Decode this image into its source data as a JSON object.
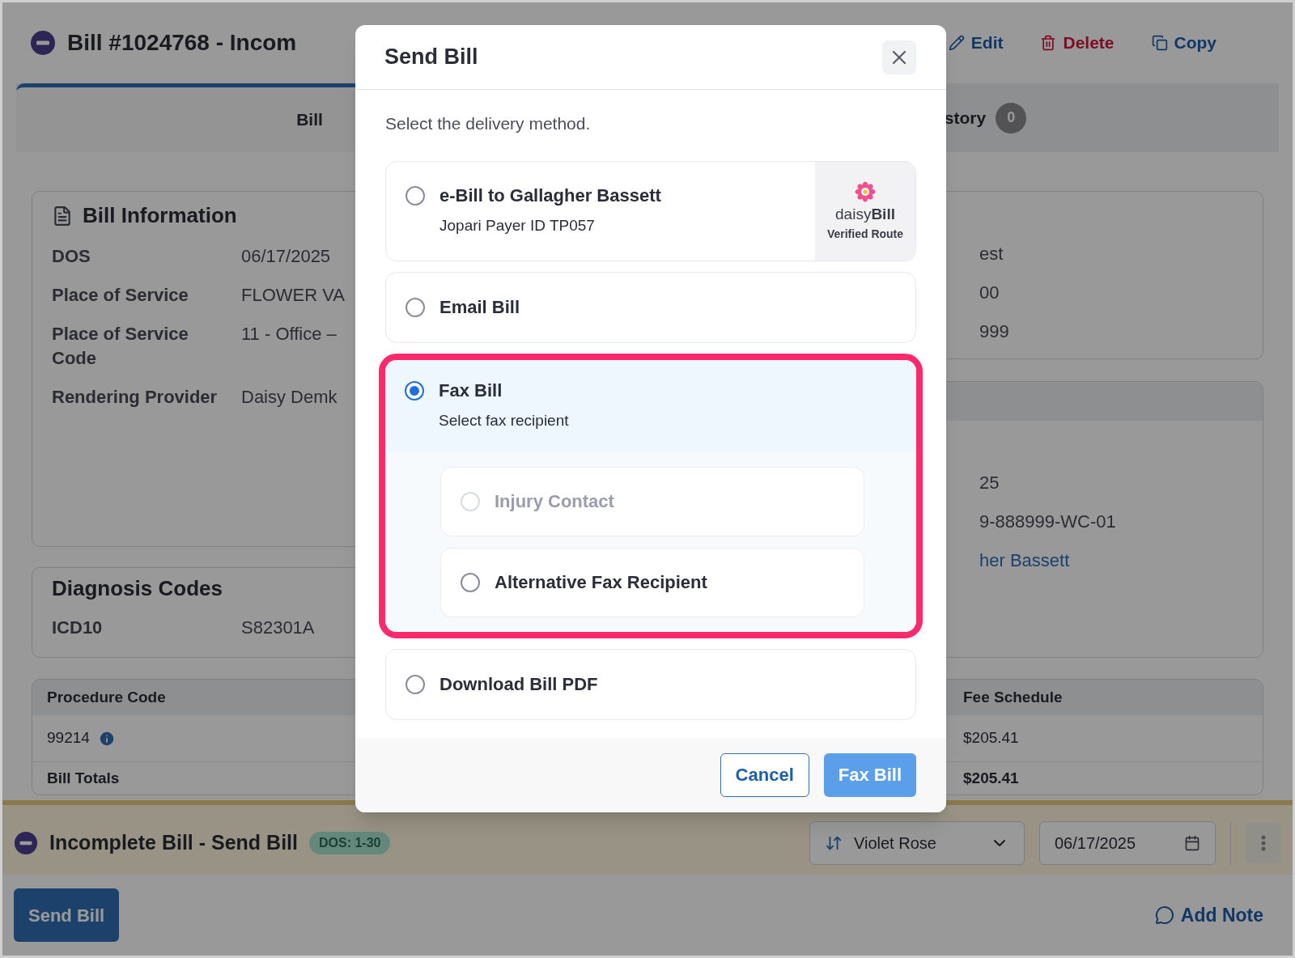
{
  "header": {
    "title": "Bill #1024768 - Incom",
    "actions": [
      {
        "label": "Edit",
        "kind": "edit"
      },
      {
        "label": "Delete",
        "kind": "delete"
      },
      {
        "label": "Copy",
        "kind": "copy"
      }
    ]
  },
  "tabs": [
    {
      "label": "Bill",
      "selected": true
    },
    {
      "label": "story",
      "count": "0",
      "selected": false
    }
  ],
  "bill_information": {
    "title": "Bill Information",
    "rows": [
      {
        "label": "DOS",
        "value": "06/17/2025"
      },
      {
        "label": "Place of Service",
        "value": "FLOWER VA"
      },
      {
        "label": "Place of Service Code",
        "value": "11 - Office –"
      },
      {
        "label": "Rendering Provider",
        "value": "Daisy Demk"
      }
    ]
  },
  "right_card_1": {
    "values": [
      "est",
      "00",
      "999"
    ]
  },
  "right_card_2": {
    "values": [
      "25",
      "9-888999-WC-01"
    ],
    "link": "her Bassett"
  },
  "diagnosis": {
    "title": "Diagnosis Codes",
    "rows": [
      {
        "code_type": "ICD10",
        "code": "S82301A"
      }
    ]
  },
  "procedures": {
    "columns": [
      "Procedure Code",
      "Fee Schedule"
    ],
    "rows": [
      {
        "procedure_code": "99214",
        "fee_schedule": "$205.41"
      }
    ],
    "totals": {
      "label": "Bill Totals",
      "fee_schedule": "$205.41"
    }
  },
  "bottom_bar": {
    "title": "Incomplete Bill - Send Bill",
    "badge": "DOS: 1-30",
    "assignee": "Violet Rose",
    "date": "06/17/2025"
  },
  "footer": {
    "primary_button": "Send Bill",
    "add_note": "Add Note"
  },
  "modal": {
    "title": "Send Bill",
    "prompt": "Select the delivery method.",
    "options": [
      {
        "kind": "ebill",
        "label": "e-Bill to Gallagher Bassett",
        "detail": "Jopari Payer ID TP057",
        "selected": false,
        "badge": {
          "brand": "daisy**Bill**",
          "caption": "Verified Route"
        }
      },
      {
        "kind": "plain",
        "label": "Email Bill",
        "selected": false
      },
      {
        "kind": "fax",
        "label": "Fax Bill",
        "detail": "Select fax recipient",
        "selected": true,
        "highlighted": true,
        "recipients": [
          {
            "label": "Injury Contact",
            "disabled": true,
            "selected": false
          },
          {
            "label": "Alternative Fax Recipient",
            "disabled": false,
            "selected": false
          }
        ]
      },
      {
        "kind": "plain",
        "label": "Download Bill PDF",
        "selected": false
      }
    ],
    "buttons": [
      {
        "label": "Cancel",
        "kind": "secondary"
      },
      {
        "label": "Fax Bill",
        "kind": "primary"
      }
    ]
  }
}
